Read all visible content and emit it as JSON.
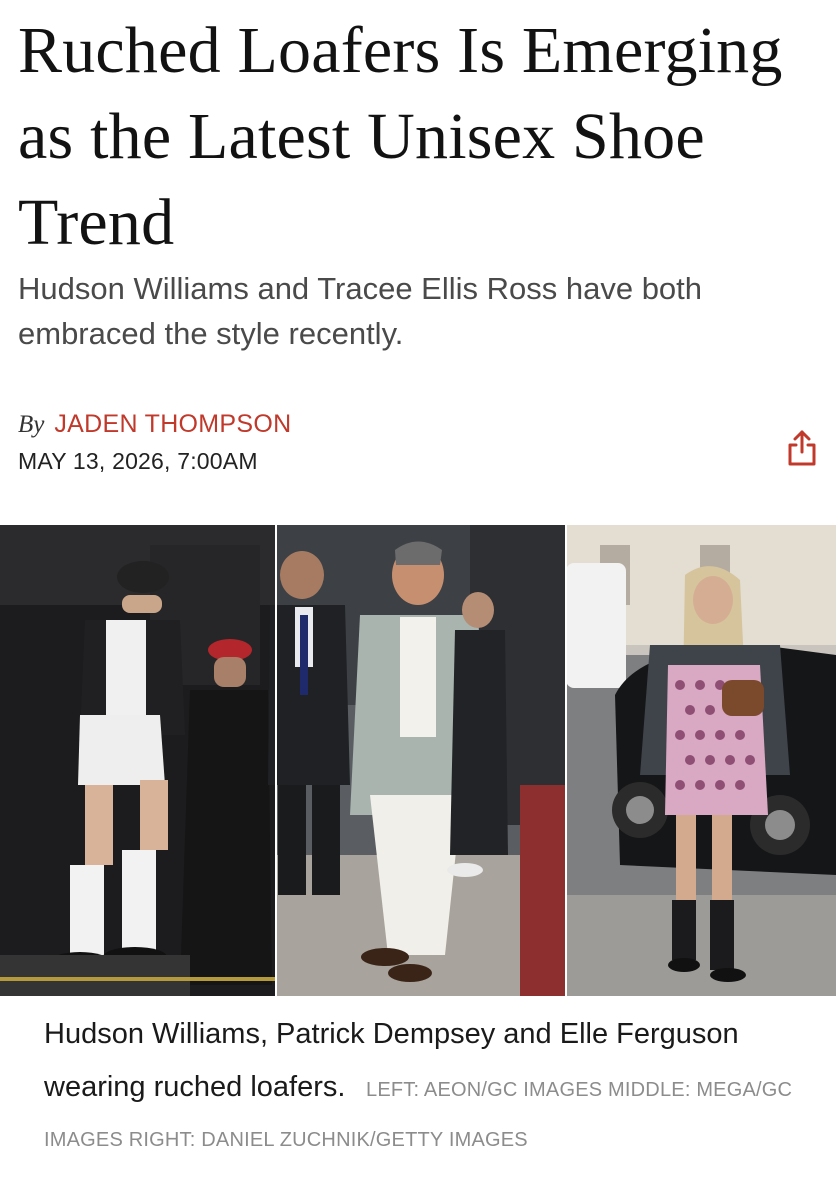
{
  "article": {
    "headline": "Ruched Loafers Is Emerging as the Latest Unisex Shoe Trend",
    "dek": "Hudson Williams and Tracee Ellis Ross have both embraced the style recently.",
    "byline_prefix": "By",
    "author": "JADEN THOMPSON",
    "date": "MAY 13, 2026, 7:00AM"
  },
  "share": {
    "icon": "share-icon"
  },
  "photo": {
    "caption": "Hudson Williams, Patrick Dempsey and Elle Ferguson wearing ruched loafers.",
    "credit": "LEFT: AEON/GC IMAGES MIDDLE: MEGA/GC IMAGES RIGHT: DANIEL ZUCHNIK/GETTY IMAGES"
  },
  "colors": {
    "accent": "#c0392b",
    "text": "#121212",
    "muted": "#8c8c8c"
  }
}
